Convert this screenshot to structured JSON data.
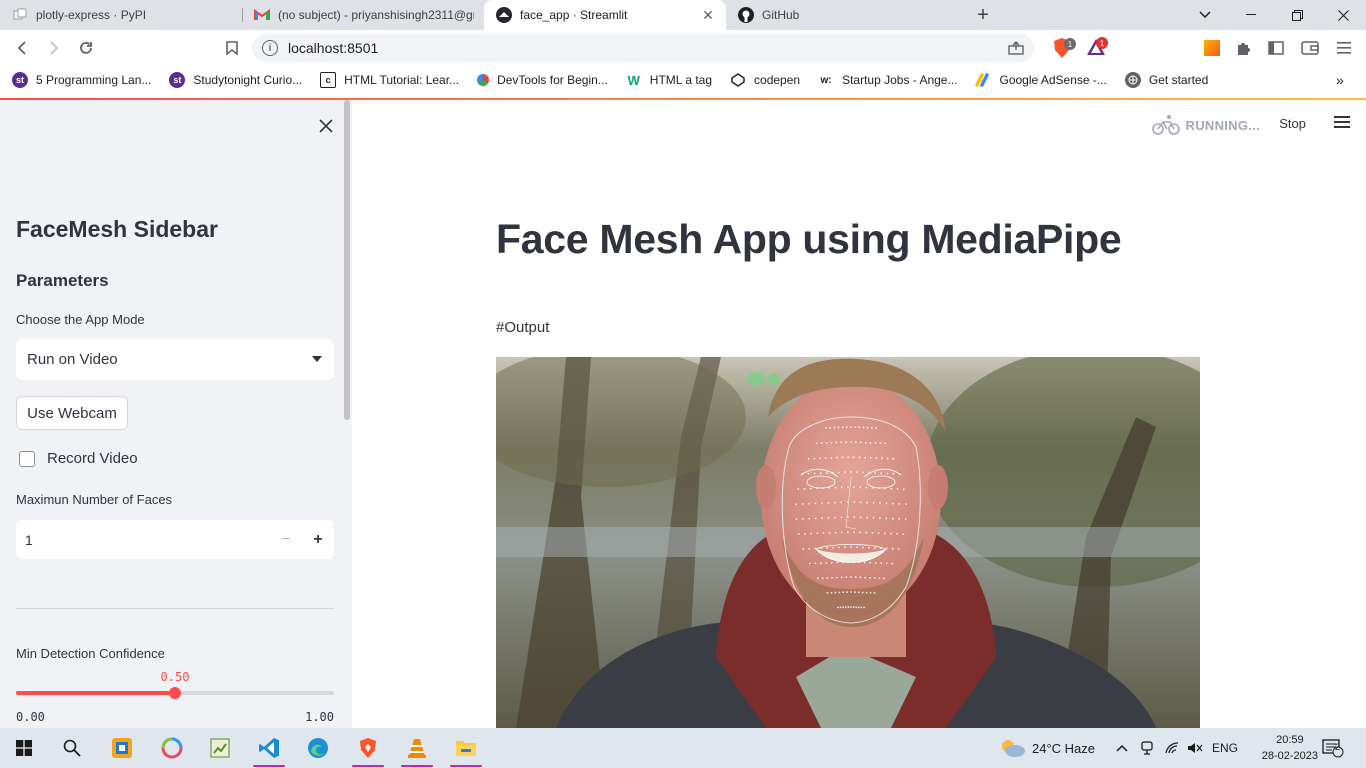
{
  "browser": {
    "tabs": [
      {
        "title": "plotly-express · PyPI",
        "active": false
      },
      {
        "title": "(no subject) - priyanshisingh2311@gm",
        "active": false
      },
      {
        "title": "face_app · Streamlit",
        "active": true
      },
      {
        "title": "GitHub",
        "active": false
      }
    ],
    "url": "localhost:8501",
    "brave_badge": "1",
    "rewards_badge": "1",
    "bookmarks": [
      {
        "label": "5 Programming Lan...",
        "icon": "studytonight-icon"
      },
      {
        "label": "Studytonight Curio...",
        "icon": "studytonight-icon"
      },
      {
        "label": "HTML Tutorial: Lear...",
        "icon": "page-icon"
      },
      {
        "label": "DevTools for Begin...",
        "icon": "devtools-icon"
      },
      {
        "label": "HTML a tag",
        "icon": "w3-icon"
      },
      {
        "label": "codepen",
        "icon": "codepen-icon"
      },
      {
        "label": "Startup Jobs - Ange...",
        "icon": "wellfound-icon"
      },
      {
        "label": "Google AdSense -...",
        "icon": "adsense-icon"
      },
      {
        "label": "Get started",
        "icon": "globe-icon"
      }
    ]
  },
  "sidebar": {
    "title": "FaceMesh Sidebar",
    "section": "Parameters",
    "app_mode_label": "Choose the App Mode",
    "app_mode_value": "Run on Video",
    "webcam_button": "Use Webcam",
    "record_label": "Record Video",
    "record_checked": false,
    "max_faces_label": "Maximun Number of Faces",
    "max_faces_value": "1",
    "min_conf_label": "Min Detection Confidence",
    "min_conf_value": "0.50",
    "min_conf_min": "0.00",
    "min_conf_max": "1.00",
    "min_conf_fraction": 0.5
  },
  "main": {
    "status": "RUNNING...",
    "stop_label": "Stop",
    "title": "Face Mesh App using MediaPipe",
    "output_label": "#Output"
  },
  "taskbar": {
    "weather": "24°C  Haze",
    "lang": "ENG",
    "time": "20:59",
    "date": "28-02-2023",
    "notifications": "2"
  },
  "colors": {
    "accent": "#ff4b4b",
    "sidebar_bg": "#f0f2f6",
    "text": "#31333f"
  }
}
